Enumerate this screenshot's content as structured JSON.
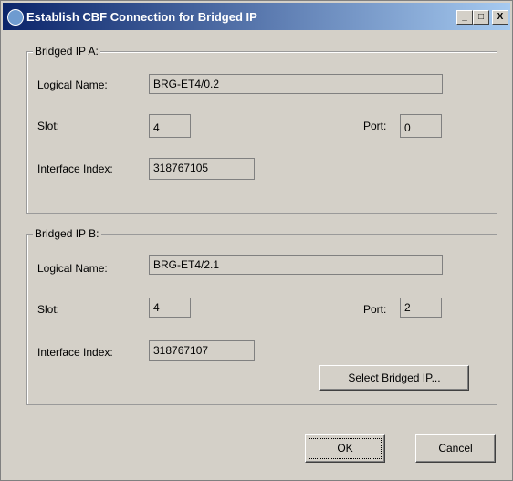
{
  "window": {
    "title": "Establish CBF Connection for Bridged IP"
  },
  "title_buttons": {
    "minimize": "_",
    "maximize": "□",
    "close": "X"
  },
  "group_a": {
    "legend": "Bridged IP A:",
    "logical_name_label": "Logical Name:",
    "logical_name": "BRG-ET4/0.2",
    "slot_label": "Slot:",
    "slot": "4",
    "port_label": "Port:",
    "port": "0",
    "interface_index_label": "Interface Index:",
    "interface_index": "318767105"
  },
  "group_b": {
    "legend": "Bridged IP B:",
    "logical_name_label": "Logical Name:",
    "logical_name": "BRG-ET4/2.1",
    "slot_label": "Slot:",
    "slot": "4",
    "port_label": "Port:",
    "port": "2",
    "interface_index_label": "Interface Index:",
    "interface_index": "318767107",
    "select_button": "Select Bridged IP..."
  },
  "footer": {
    "ok": "OK",
    "cancel": "Cancel"
  }
}
